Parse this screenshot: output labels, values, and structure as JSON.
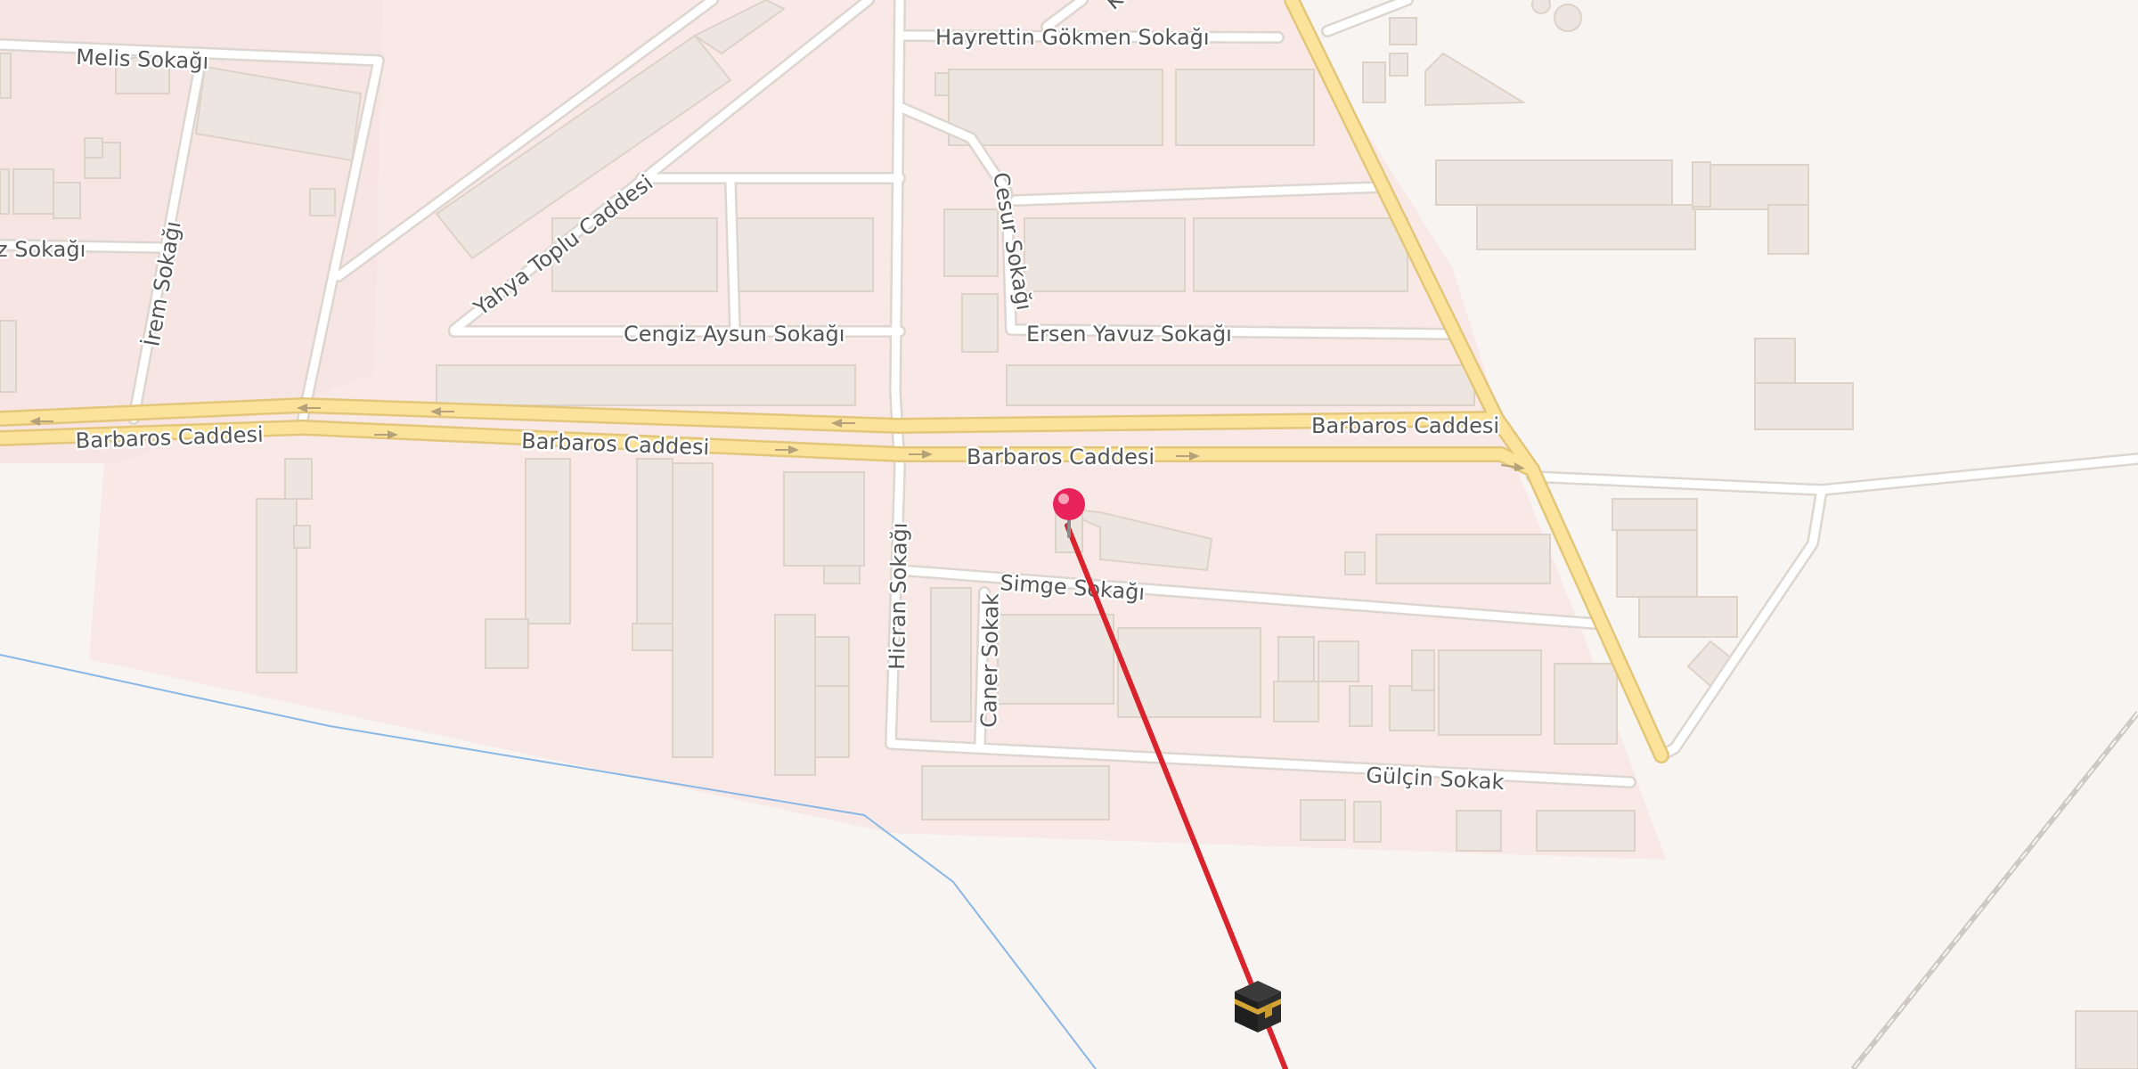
{
  "map": {
    "streets": [
      "Melis Sokağı",
      "z Sokağı",
      "İrem Sokağı",
      "Yahya Toplu Caddesi",
      "Hayrettin Gökmen Sokağı",
      "Cesur Sokağı",
      "Cengiz Aysun Sokağı",
      "Ersen Yavuz Sokağı",
      "Barbaros Caddesi",
      "Barbaros Caddesi",
      "Barbaros Caddesi",
      "Barbaros Caddesi",
      "Simge Sokağı",
      "Hicran Sokağı",
      "Caner Sokak",
      "Gülçin Sokak",
      "K"
    ],
    "marker": {
      "type": "location-pin",
      "color": "#e8235a"
    },
    "qibla_line": {
      "color": "#d9232d",
      "destination_icon": "kaaba-icon"
    },
    "colors": {
      "background": "#f7f4f1",
      "residential": "#f8e8e6",
      "main_road": "#fce39b",
      "main_road_casing": "#e3c679",
      "minor_road": "#ffffff",
      "building": "#ede6e0",
      "water_line": "#8ab8e6",
      "rail": "#c8c2bc"
    }
  }
}
